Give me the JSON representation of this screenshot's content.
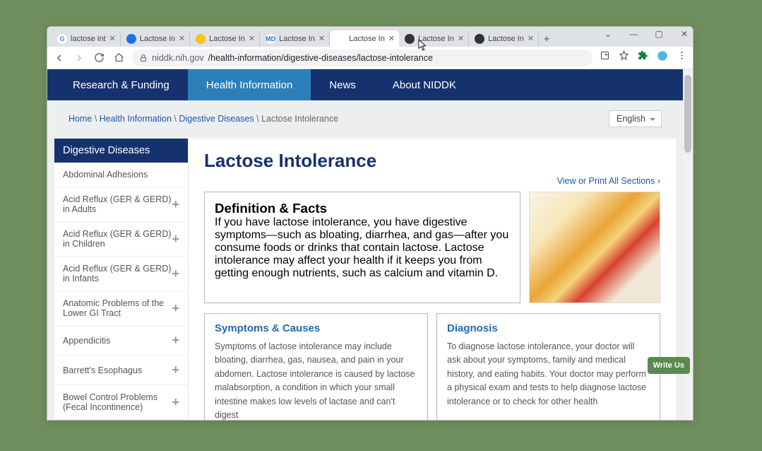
{
  "browser": {
    "tabs": [
      {
        "label": "lactose int",
        "favicon_bg": "#fff",
        "favicon_text": "G",
        "favicon_color": "#4285f4"
      },
      {
        "label": "Lactose in",
        "favicon_bg": "#1a73e8",
        "favicon_text": "",
        "favicon_color": "#fff"
      },
      {
        "label": "Lactose In",
        "favicon_bg": "#f5c518",
        "favicon_text": "",
        "favicon_color": "#333"
      },
      {
        "label": "Lactose In",
        "favicon_bg": "#fff",
        "favicon_text": "MD",
        "favicon_color": "#2a6ebb"
      },
      {
        "label": "Lactose In",
        "favicon_bg": "#fff",
        "favicon_text": "",
        "favicon_color": "#206ab0",
        "active": true
      },
      {
        "label": "Lactose In",
        "favicon_bg": "#333",
        "favicon_text": "",
        "favicon_color": "#fff"
      },
      {
        "label": "Lactose In",
        "favicon_bg": "#333",
        "favicon_text": "",
        "favicon_color": "#fff"
      }
    ],
    "url_host": "niddk.nih.gov",
    "url_path": "/health-information/digestive-diseases/lactose-intolerance"
  },
  "topnav": {
    "items": [
      {
        "label": "Research & Funding"
      },
      {
        "label": "Health Information",
        "active": true
      },
      {
        "label": "News"
      },
      {
        "label": "About NIDDK"
      }
    ]
  },
  "breadcrumb": {
    "items": [
      "Home",
      "Health Information",
      "Digestive Diseases"
    ],
    "current": "Lactose Intolerance",
    "sep": " \\ "
  },
  "language": "English",
  "sidebar": {
    "title": "Digestive Diseases",
    "items": [
      {
        "label": "Abdominal Adhesions",
        "expandable": false
      },
      {
        "label": "Acid Reflux (GER & GERD) in Adults",
        "expandable": true
      },
      {
        "label": "Acid Reflux (GER & GERD) in Children",
        "expandable": true
      },
      {
        "label": "Acid Reflux (GER & GERD) in Infants",
        "expandable": true
      },
      {
        "label": "Anatomic Problems of the Lower GI Tract",
        "expandable": true
      },
      {
        "label": "Appendicitis",
        "expandable": true
      },
      {
        "label": "Barrett's Esophagus",
        "expandable": true
      },
      {
        "label": "Bowel Control Problems (Fecal Incontinence)",
        "expandable": true
      }
    ]
  },
  "page_title": "Lactose Intolerance",
  "print_link": "View or Print All Sections",
  "sections": {
    "definition": {
      "title": "Definition & Facts",
      "body": "If you have lactose intolerance, you have digestive symptoms—such as bloating, diarrhea, and gas—after you consume foods or drinks that contain lactose. Lactose intolerance may affect your health if it keeps you from getting enough nutrients, such as calcium and vitamin D."
    },
    "symptoms": {
      "title": "Symptoms & Causes",
      "body": "Symptoms of lactose intolerance may include bloating, diarrhea, gas, nausea, and pain in your abdomen. Lactose intolerance is caused by lactose malabsorption, a condition in which your small intestine makes low levels of lactase and can't digest"
    },
    "diagnosis": {
      "title": "Diagnosis",
      "body": "To diagnose lactose intolerance, your doctor will ask about your symptoms, family and medical history, and eating habits. Your doctor may perform a physical exam and tests to help diagnose lactose intolerance or to check for other health"
    }
  },
  "write_us": "Write\nUs"
}
